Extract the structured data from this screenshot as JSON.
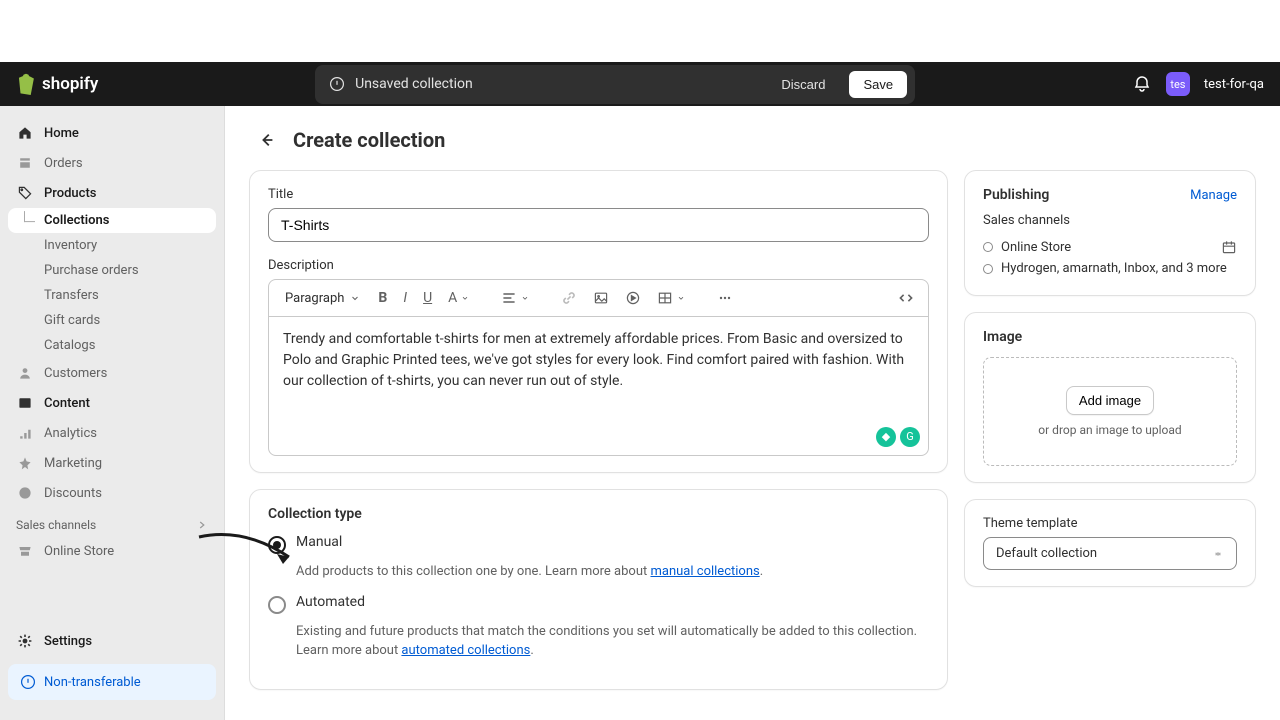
{
  "brand": "shopify",
  "savebar": {
    "status": "Unsaved collection",
    "discard": "Discard",
    "save": "Save"
  },
  "user": {
    "initials": "tes",
    "name": "test-for-qa"
  },
  "sidebar": {
    "items": [
      "Home",
      "Orders",
      "Products"
    ],
    "subs": [
      "Collections",
      "Inventory",
      "Purchase orders",
      "Transfers",
      "Gift cards",
      "Catalogs"
    ],
    "more": [
      "Customers",
      "Content",
      "Analytics",
      "Marketing",
      "Discounts"
    ],
    "section": "Sales channels",
    "channels": [
      "Online Store"
    ],
    "settings": "Settings",
    "nontransfer": "Non-transferable"
  },
  "page": {
    "title": "Create collection"
  },
  "title": {
    "label": "Title",
    "value": "T-Shirts"
  },
  "desc": {
    "label": "Description",
    "paragraph": "Paragraph",
    "text": "Trendy and comfortable t-shirts for men at extremely affordable prices. From Basic and oversized to Polo and Graphic Printed tees, we've got styles for every look. Find comfort paired with fashion. With our collection of t-shirts, you can never run out of style."
  },
  "collectionType": {
    "title": "Collection type",
    "manual": {
      "label": "Manual",
      "desc_pre": "Add products to this collection one by one. Learn more about ",
      "link": "manual collections"
    },
    "auto": {
      "label": "Automated",
      "desc_pre": "Existing and future products that match the conditions you set will automatically be added to this collection. Learn more about ",
      "link": "automated collections"
    }
  },
  "publishing": {
    "title": "Publishing",
    "manage": "Manage",
    "sales": "Sales channels",
    "ch1": "Online Store",
    "ch2": "Hydrogen, amarnath, Inbox, and 3 more"
  },
  "image": {
    "title": "Image",
    "add": "Add image",
    "drop": "or drop an image to upload"
  },
  "theme": {
    "label": "Theme template",
    "value": "Default collection"
  }
}
